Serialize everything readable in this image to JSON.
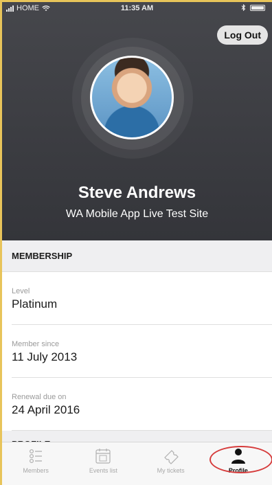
{
  "status_bar": {
    "carrier": "HOME",
    "time": "11:35 AM"
  },
  "header": {
    "logout_label": "Log Out",
    "user_name": "Steve Andrews",
    "site_name": "WA Mobile App Live Test Site"
  },
  "membership": {
    "title": "MEMBERSHIP",
    "fields": [
      {
        "label": "Level",
        "value": "Platinum"
      },
      {
        "label": "Member since",
        "value": "11 July 2013"
      },
      {
        "label": "Renewal due on",
        "value": "24 April 2016"
      }
    ]
  },
  "profile_section": {
    "title": "PROFILE"
  },
  "tabs": [
    {
      "label": "Members",
      "icon": "members-list-icon"
    },
    {
      "label": "Events list",
      "icon": "calendar-icon"
    },
    {
      "label": "My tickets",
      "icon": "ticket-icon"
    },
    {
      "label": "Profile",
      "icon": "person-icon",
      "active": true
    }
  ],
  "colors": {
    "header_bg": "#3d3e43",
    "section_bg": "#efeff1",
    "highlight_circle": "#d63b3b",
    "frame_border": "#e8c45a"
  }
}
